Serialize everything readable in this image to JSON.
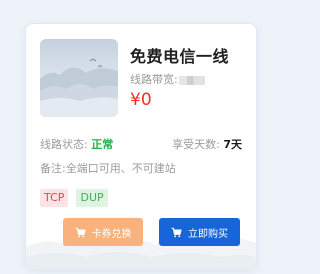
{
  "product": {
    "title": "免费电信一线",
    "bandwidth_label": "线路带宽:",
    "price": "¥0"
  },
  "info": {
    "status_label": "线路状态:",
    "status_value": "正常",
    "days_label": "享受天数:",
    "days_value": "7天",
    "note": "备注:全端口可用、不可建站"
  },
  "tags": [
    "TCP",
    "DUP"
  ],
  "actions": {
    "exchange_label": "卡券兑换",
    "buy_label": "立即购买"
  },
  "colors": {
    "price": "#ff2a2a",
    "status_ok": "#22b14c",
    "tag_tcp_bg": "#fde3e6",
    "tag_tcp_text": "#e0445a",
    "tag_dup_bg": "#dff3e3",
    "tag_dup_text": "#3bb05a",
    "exchange_button": "#f9b27c",
    "buy_button": "#1765d8"
  },
  "icons": {
    "exchange": "cart-icon",
    "buy": "cart-icon"
  }
}
